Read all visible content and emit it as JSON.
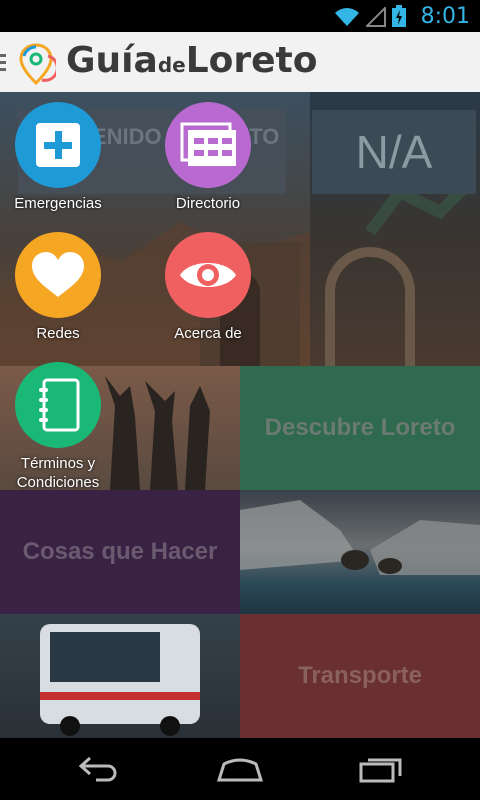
{
  "status_bar": {
    "time": "8:01",
    "icons": [
      "wifi-icon",
      "signal-icon",
      "battery-charging-icon"
    ],
    "accent_color": "#33b5e5"
  },
  "action_bar": {
    "title_part1": "Guía",
    "title_part2": "de",
    "title_part3": "Loreto",
    "logo_icon": "location-pin-icon"
  },
  "background": {
    "welcome_text": "BIENVENIDO A LORETO",
    "na_text": "N/A",
    "tiles": [
      {
        "label": "Descubre Loreto",
        "color": "#2f6a4e"
      },
      {
        "label": "Cosas que Hacer",
        "color": "#3a2244"
      },
      {
        "label": "Transporte",
        "color": "#6a2f30"
      }
    ]
  },
  "menu": {
    "items": [
      {
        "label": "Emergencias",
        "icon": "plus-icon",
        "color": "#1e9ad6"
      },
      {
        "label": "Directorio",
        "icon": "directory-icon",
        "color": "#b86ad0"
      },
      {
        "label": "Redes",
        "icon": "heart-icon",
        "color": "#f5a623"
      },
      {
        "label": "Acerca de",
        "icon": "eye-icon",
        "color": "#f06060"
      },
      {
        "label": "Términos y Condiciones",
        "icon": "notebook-icon",
        "color": "#1ab877"
      }
    ]
  },
  "nav_bar": {
    "buttons": [
      "back-icon",
      "home-icon",
      "recent-apps-icon"
    ]
  }
}
